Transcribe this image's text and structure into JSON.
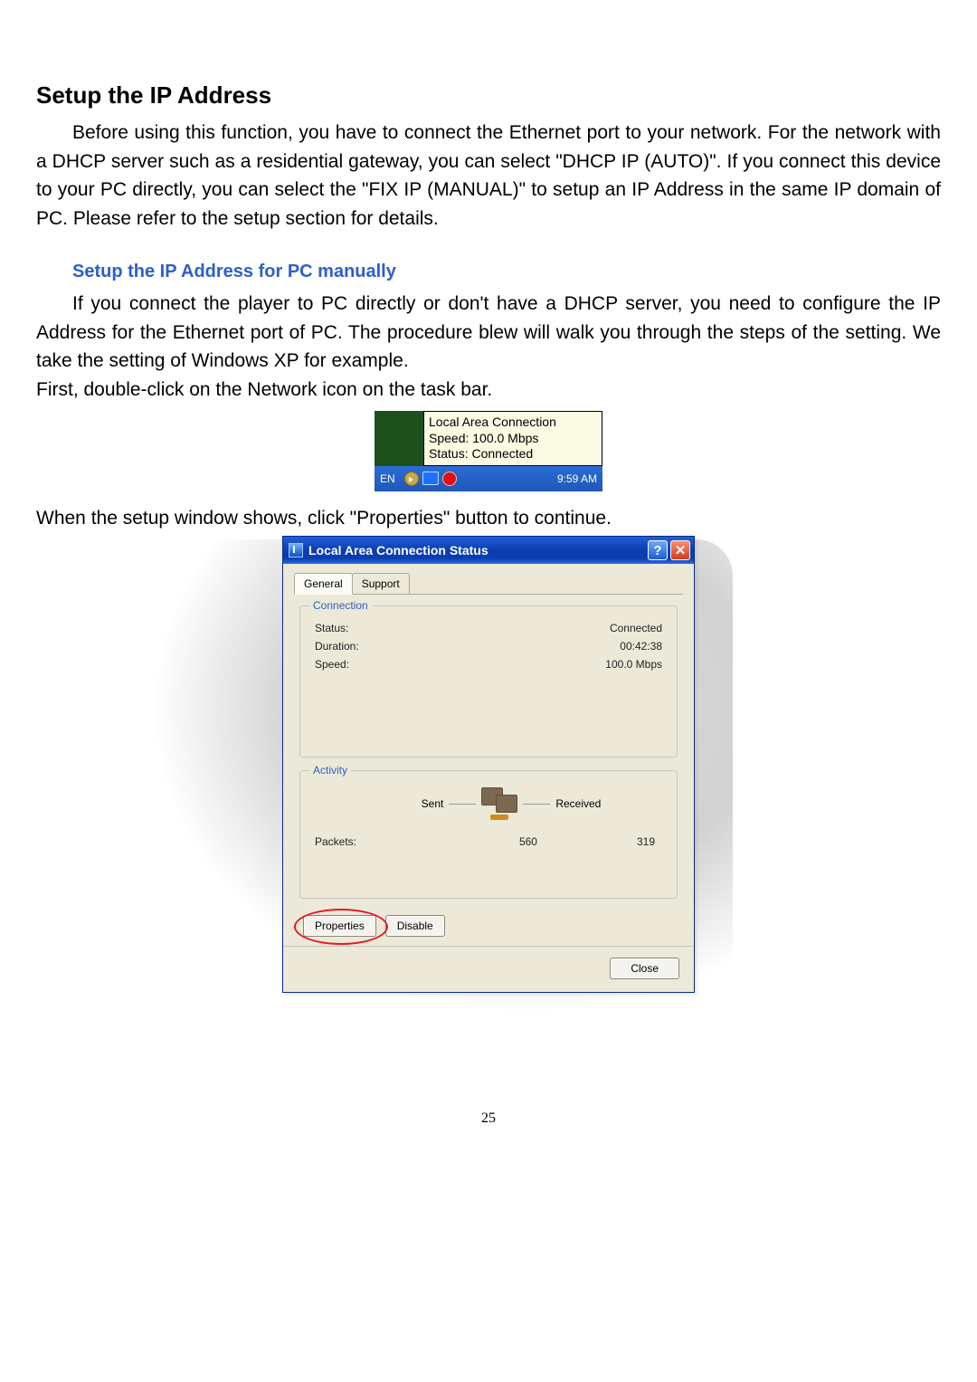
{
  "heading": "Setup the IP Address",
  "para1": "Before using this function, you have to connect the Ethernet port to your network. For the network with a DHCP server such as a residential gateway, you can select \"DHCP IP (AUTO)\". If you connect this device to your PC directly, you can select the \"FIX IP (MANUAL)\" to setup an IP Address in the same IP domain of PC. Please refer to the setup section for details.",
  "subheading": "Setup the IP Address for PC manually",
  "para2": "If you connect the player to PC directly or don't have a DHCP server, you need to configure the IP Address for the Ethernet port of PC. The procedure blew will walk you through the steps of the setting. We take the setting of Windows XP for example.",
  "para3": "First, double-click on the Network icon on the task bar.",
  "taskbar": {
    "tooltip_line1": "Local Area Connection",
    "tooltip_line2": "Speed: 100.0 Mbps",
    "tooltip_line3": "Status: Connected",
    "lang": "EN",
    "time": "9:59 AM"
  },
  "para4": "When the setup window shows, click \"Properties\" button to continue.",
  "dialog": {
    "title": "Local Area Connection Status",
    "tab_general": "General",
    "tab_support": "Support",
    "group_connection": "Connection",
    "status_label": "Status:",
    "status_value": "Connected",
    "duration_label": "Duration:",
    "duration_value": "00:42:38",
    "speed_label": "Speed:",
    "speed_value": "100.0 Mbps",
    "group_activity": "Activity",
    "sent_label": "Sent",
    "received_label": "Received",
    "packets_label": "Packets:",
    "packets_sent": "560",
    "packets_received": "319",
    "btn_properties": "Properties",
    "btn_disable": "Disable",
    "btn_close": "Close"
  },
  "page_number": "25"
}
